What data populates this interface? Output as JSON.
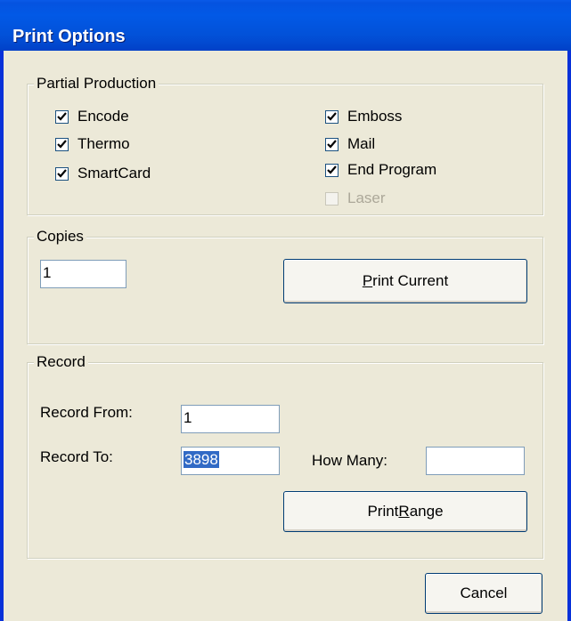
{
  "window": {
    "title": "Print Options"
  },
  "partial_production": {
    "legend": "Partial Production",
    "left": [
      {
        "label": "Encode",
        "checked": true,
        "enabled": true
      },
      {
        "label": "Thermo",
        "checked": true,
        "enabled": true
      },
      {
        "label": "SmartCard",
        "checked": true,
        "enabled": true
      }
    ],
    "right": [
      {
        "label": "Emboss",
        "checked": true,
        "enabled": true
      },
      {
        "label": "Mail",
        "checked": true,
        "enabled": true
      },
      {
        "label": "End Program",
        "checked": true,
        "enabled": true
      },
      {
        "label": "Laser",
        "checked": false,
        "enabled": false
      }
    ]
  },
  "copies": {
    "legend": "Copies",
    "value": "1",
    "print_current_button": {
      "prefix": "",
      "mnemonic": "P",
      "suffix": "rint Current"
    }
  },
  "record": {
    "legend": "Record",
    "from_label": "Record From:",
    "from_value": "1",
    "to_label": "Record To:",
    "to_value": "3898",
    "how_many_label": "How Many:",
    "how_many_value": "",
    "print_range_button": {
      "prefix": "Print ",
      "mnemonic": "R",
      "suffix": "ange"
    }
  },
  "cancel_button": {
    "label": "Cancel"
  }
}
